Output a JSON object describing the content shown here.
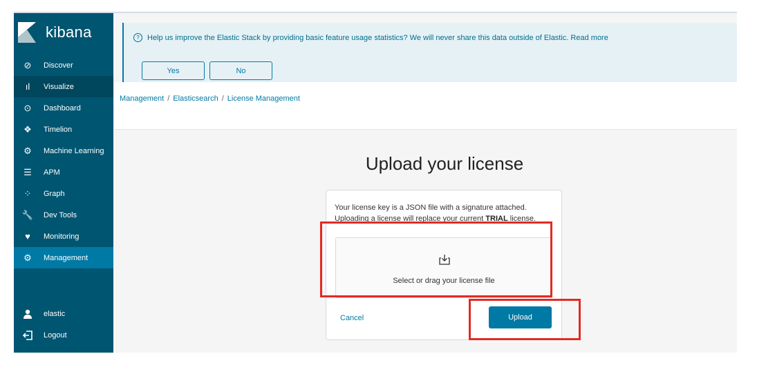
{
  "app": {
    "name": "kibana"
  },
  "sidebar": {
    "items": [
      {
        "label": "Discover",
        "icon": "compass-icon",
        "glyph": "⊘"
      },
      {
        "label": "Visualize",
        "icon": "bar-chart-icon",
        "glyph": "ıl"
      },
      {
        "label": "Dashboard",
        "icon": "dashboard-icon",
        "glyph": "⊙"
      },
      {
        "label": "Timelion",
        "icon": "timelion-icon",
        "glyph": "❖"
      },
      {
        "label": "Machine Learning",
        "icon": "machine-learning-icon",
        "glyph": "⚙"
      },
      {
        "label": "APM",
        "icon": "apm-icon",
        "glyph": "☰"
      },
      {
        "label": "Graph",
        "icon": "graph-icon",
        "glyph": "⁘"
      },
      {
        "label": "Dev Tools",
        "icon": "wrench-icon",
        "glyph": "🔧"
      },
      {
        "label": "Monitoring",
        "icon": "heartbeat-icon",
        "glyph": "♥"
      },
      {
        "label": "Management",
        "icon": "gear-icon",
        "glyph": "⚙"
      }
    ],
    "user": {
      "label": "elastic"
    },
    "logout": {
      "label": "Logout"
    }
  },
  "banner": {
    "text": "Help us improve the Elastic Stack by providing basic feature usage statistics? We will never share this data outside of Elastic. Read more",
    "yes": "Yes",
    "no": "No"
  },
  "breadcrumb": {
    "items": [
      "Management",
      "Elasticsearch",
      "License Management"
    ],
    "separator": "/"
  },
  "page": {
    "title": "Upload your license"
  },
  "panel": {
    "desc_line1": "Your license key is a JSON file with a signature attached.",
    "desc_line2_prefix": "Uploading a license will replace your current",
    "desc_line2_bold": "TRIAL",
    "desc_line2_suffix": "license.",
    "dropzone_text": "Select or drag your license file",
    "cancel": "Cancel",
    "upload": "Upload"
  },
  "colors": {
    "sidebar": "#005571",
    "accent": "#0079a5",
    "highlight": "#e12b22"
  }
}
